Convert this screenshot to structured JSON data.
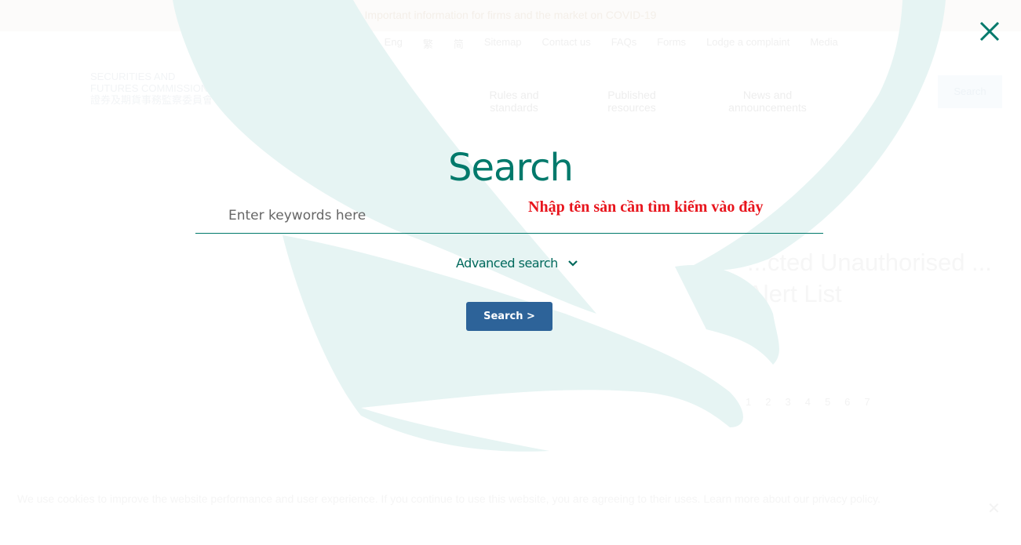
{
  "background": {
    "banner": "Important information for firms and the market on COVID-19",
    "top_links": [
      "A",
      "Eng",
      "繁",
      "简",
      "Sitemap",
      "Contact us",
      "FAQs",
      "Forms",
      "Lodge a complaint",
      "Media"
    ],
    "logo": {
      "line1": "SECURITIES AND",
      "line2": "FUTURES COMMISSION",
      "line3": "證券及期貨事務監察委員會"
    },
    "main_nav": [
      "Rules and standards",
      "Published resources",
      "News and announcements"
    ],
    "search_button": "Search",
    "page_title": "...cted Unauthorised ... Alert List",
    "pagination": [
      "1",
      "2",
      "3",
      "4",
      "5",
      "6",
      "7"
    ],
    "cookie_notice": "We use cookies to improve the website performance and user experience. If you continue to use this website, you are agreeing to their uses. Learn more about our privacy policy."
  },
  "overlay": {
    "title": "Search",
    "input_placeholder": "Enter keywords here",
    "input_value": "",
    "annotation": "Nhập tên sàn cần tìm kiếm vào đây",
    "advanced_search_label": "Advanced search",
    "search_button_label": "Search >",
    "icons": {
      "close": "close-icon",
      "advanced": "chevron-down-icon"
    }
  },
  "colors": {
    "accent": "#00796b",
    "button": "#2d6399",
    "annotation": "#e8141c",
    "eagle": "#e6f4f3"
  }
}
